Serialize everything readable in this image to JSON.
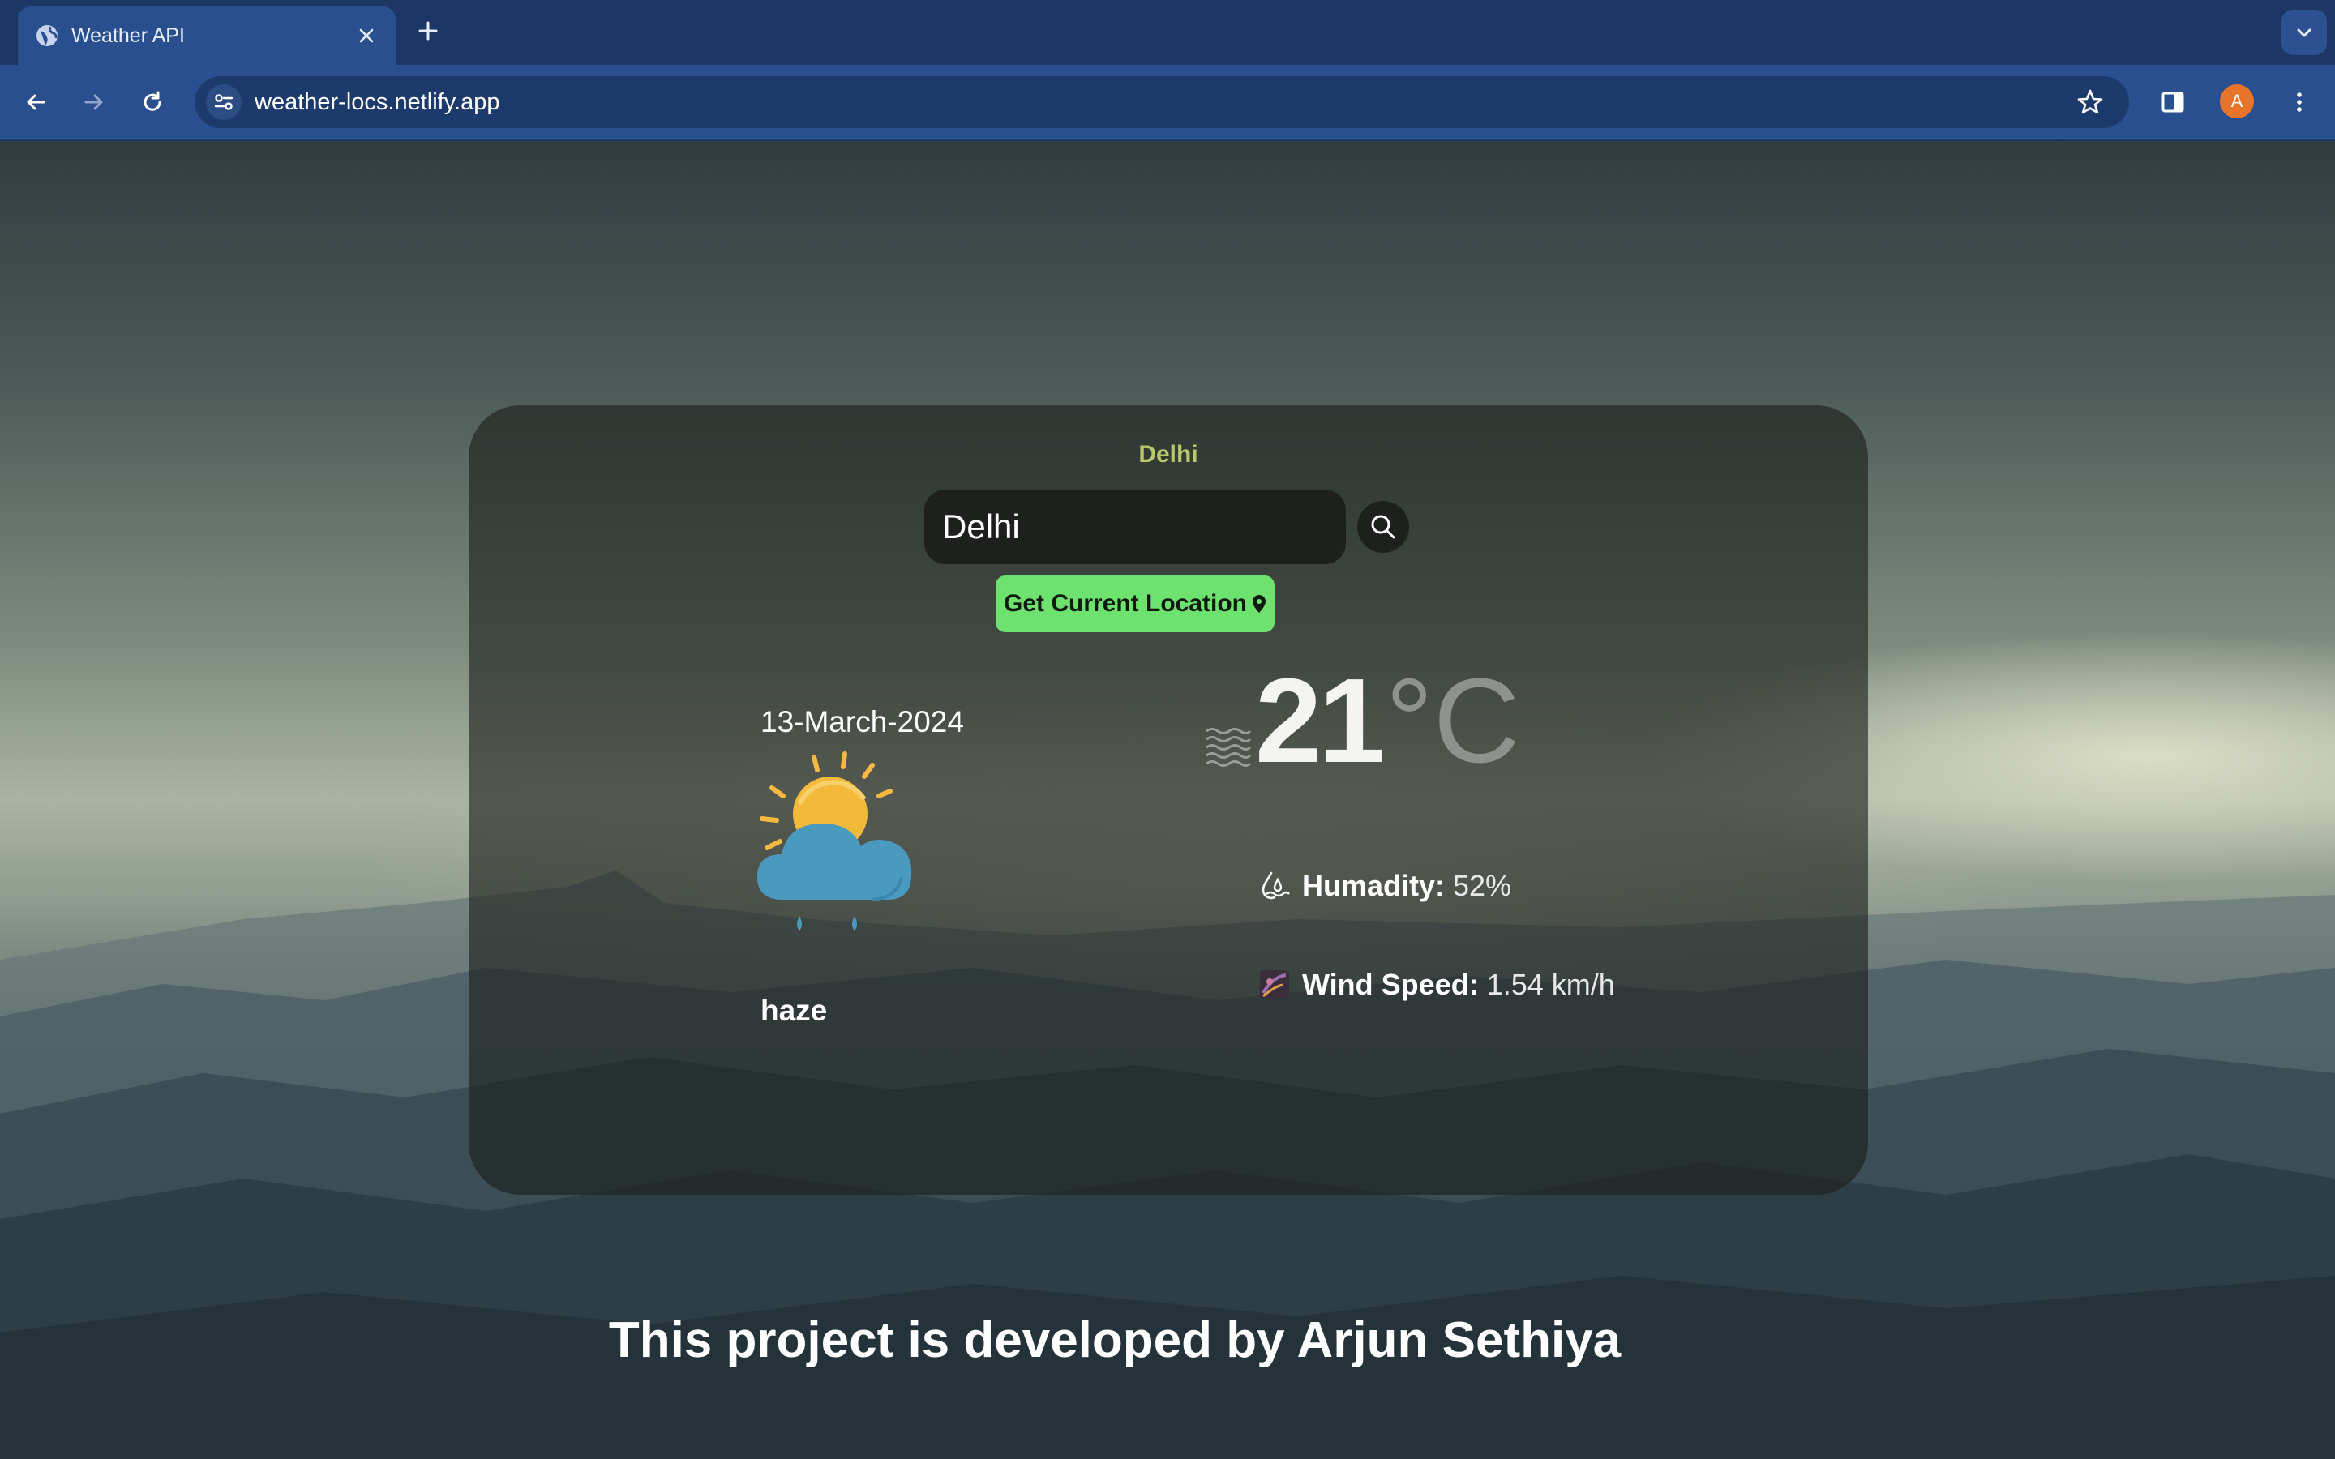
{
  "browser": {
    "tab_title": "Weather API",
    "url": "weather-locs.netlify.app",
    "profile_initial": "A",
    "icons": [
      "globe-icon",
      "close-icon",
      "plus-icon",
      "chevron-down-icon",
      "back-arrow-icon",
      "forward-arrow-icon",
      "reload-icon",
      "site-settings-icon",
      "star-icon",
      "side-panel-icon",
      "kebab-menu-icon"
    ]
  },
  "weather": {
    "city": "Delhi",
    "search_value": "Delhi",
    "location_button_label": "Get Current Location",
    "date": "13-March-2024",
    "condition": "haze",
    "temperature_value": "21",
    "temperature_unit": "°C",
    "humidity_label": "Humadity:",
    "humidity_value": "52%",
    "wind_label": "Wind Speed:",
    "wind_value": "1.54 km/h"
  },
  "footer": {
    "credit": "This project is developed by Arjun Sethiya"
  },
  "colors": {
    "city_accent": "#b8c768",
    "location_button": "#6ee26f",
    "chrome_blue": "#2a4f8f"
  }
}
